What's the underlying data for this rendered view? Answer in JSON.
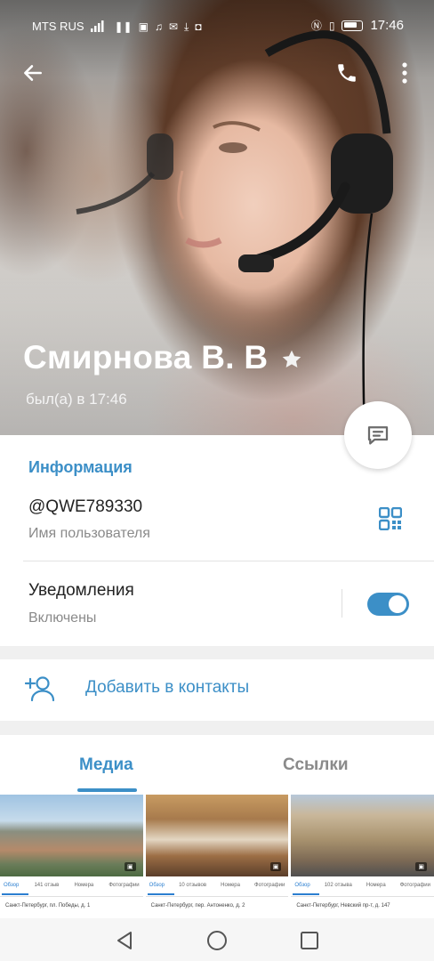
{
  "status_bar": {
    "carrier": "MTS RUS",
    "time": "17:46"
  },
  "profile": {
    "name": "Смирнова В. В",
    "last_seen": "был(а) в 17:46"
  },
  "info": {
    "section_title": "Информация",
    "username": "@QWE789330",
    "username_caption": "Имя пользователя",
    "notifications_label": "Уведомления",
    "notifications_state": "Включены",
    "notifications_enabled": true
  },
  "actions": {
    "add_contact_label": "Добавить в контакты"
  },
  "media_tabs": {
    "tabs": [
      {
        "label": "Медиа",
        "active": true
      },
      {
        "label": "Ссылки",
        "active": false
      }
    ]
  },
  "thumbnails": [
    {
      "tabs": [
        "Обзор",
        "141 отзыв",
        "Номера",
        "Фотографии"
      ],
      "address": "Санкт-Петербург, пл. Победы, д. 1"
    },
    {
      "tabs": [
        "Обзор",
        "10 отзывов",
        "Номера",
        "Фотографии"
      ],
      "address": "Санкт-Петербург, пер. Антоненко, д. 2"
    },
    {
      "tabs": [
        "Обзор",
        "102 отзыва",
        "Номера",
        "Фотографии"
      ],
      "address": "Санкт-Петербург, Невский пр-т, д. 147"
    }
  ],
  "colors": {
    "accent": "#3c8fc7",
    "background": "#f0f0f0",
    "card": "#ffffff"
  },
  "icons": {
    "back": "arrow-left-icon",
    "call": "phone-icon",
    "menu": "more-vertical-icon",
    "message": "message-icon",
    "qr": "qr-code-icon",
    "add_contact": "add-user-icon",
    "star": "star-icon"
  }
}
